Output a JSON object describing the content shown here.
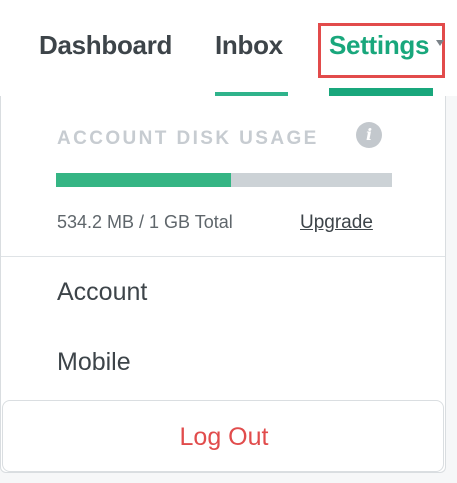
{
  "nav": {
    "items": [
      {
        "label": "Dashboard"
      },
      {
        "label": "Inbox"
      },
      {
        "label": "Settings"
      }
    ],
    "active_color": "#19a77c",
    "highlight_color": "#e24b4b"
  },
  "dropdown": {
    "disk_usage": {
      "title": "ACCOUNT DISK USAGE",
      "info_icon": "info-icon",
      "used_fraction": 0.52,
      "usage_text": "534.2 MB / 1 GB Total",
      "upgrade_label": "Upgrade",
      "bar_fill_color": "#35b584"
    },
    "menu": [
      {
        "label": "Account"
      },
      {
        "label": "Mobile"
      }
    ],
    "logout_label": "Log Out"
  }
}
